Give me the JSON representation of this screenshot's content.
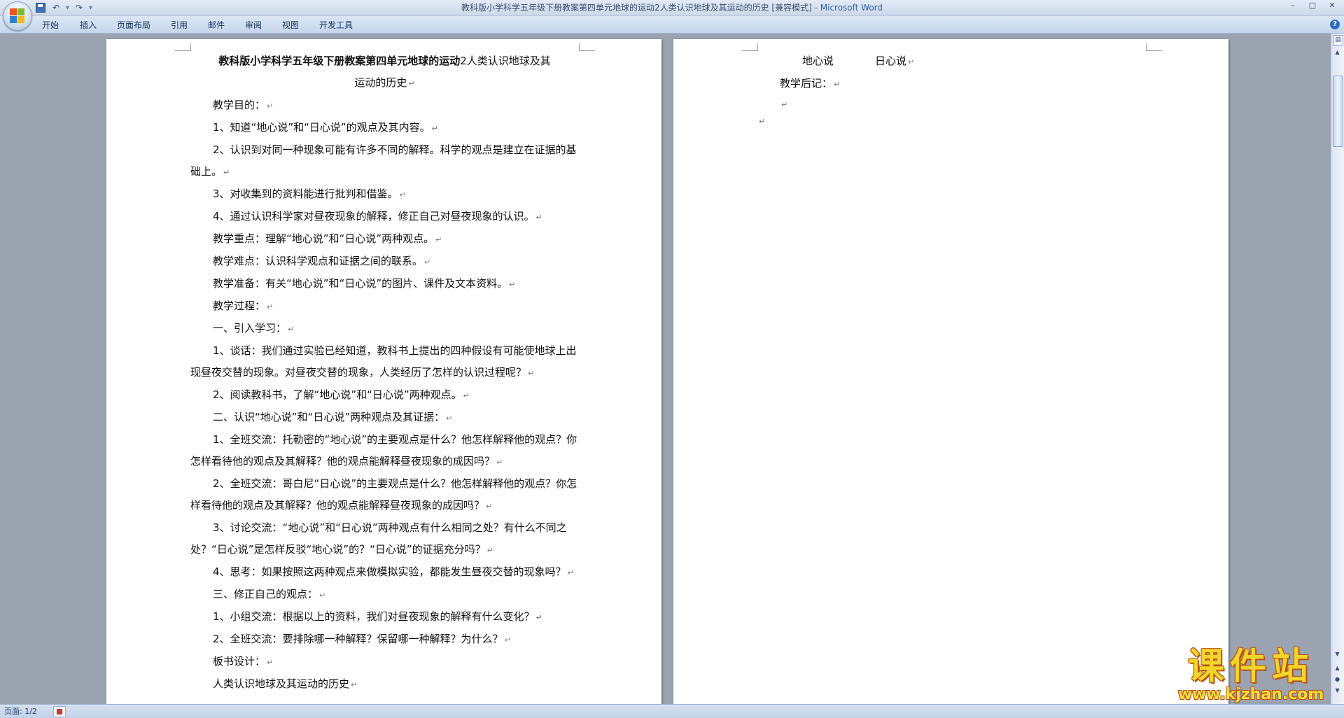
{
  "window": {
    "title_doc": "教科版小学科学五年级下册教案第四单元地球的运动2人类认识地球及其运动的历史 [兼容模式]",
    "title_sep": " - ",
    "title_app": "Microsoft Word",
    "minimize": "–",
    "maximize": "□",
    "close": "✕"
  },
  "qat": {
    "undo": "↶",
    "dropdown": "▾",
    "redo": "↷",
    "customize": "▾"
  },
  "ribbon": {
    "tabs": [
      "开始",
      "插入",
      "页面布局",
      "引用",
      "邮件",
      "审阅",
      "视图",
      "开发工具"
    ],
    "help": "?"
  },
  "document": {
    "paragraph_mark": "↵",
    "page1": {
      "title_bold": "教科版小学科学五年级下册教案第四单元地球的运动",
      "title_rest": "2人类认识地球及其",
      "title_line2": "运动的历史",
      "lines": [
        "教学目的：",
        "1、知道“地心说”和“日心说”的观点及其内容。",
        "2、认识到对同一种现象可能有许多不同的解释。科学的观点是建立在证据的基础上。",
        "3、对收集到的资料能进行批判和借鉴。",
        "4、通过认识科学家对昼夜现象的解释，修正自己对昼夜现象的认识。",
        "教学重点：理解“地心说”和“日心说”两种观点。",
        "教学难点：认识科学观点和证据之间的联系。",
        "教学准备：有关“地心说”和“日心说”的图片、课件及文本资料。",
        "教学过程：",
        "一、引入学习：",
        "1、谈话：我们通过实验已经知道，教科书上提出的四种假设有可能使地球上出现昼夜交替的现象。对昼夜交替的现象，人类经历了怎样的认识过程呢？",
        "2、阅读教科书，了解“地心说”和“日心说”两种观点。",
        "二、认识“地心说”和“日心说”两种观点及其证据：",
        "1、全班交流：托勒密的“地心说”的主要观点是什么？他怎样解释他的观点？你怎样看待他的观点及其解释？他的观点能解释昼夜现象的成因吗？",
        "2、全班交流：哥白尼“日心说”的主要观点是什么？他怎样解释他的观点？你怎样看待他的观点及其解释？他的观点能解释昼夜现象的成因吗？",
        "3、讨论交流：“地心说”和“日心说”两种观点有什么相同之处？有什么不同之处？“日心说”是怎样反驳“地心说”的？“日心说”的证据充分吗？",
        "4、思考：如果按照这两种观点来做模拟实验，都能发生昼夜交替的现象吗？",
        "三、修正自己的观点：",
        "1、小组交流：根据以上的资料，我们对昼夜现象的解释有什么变化？",
        "2、全班交流：要排除哪一种解释？保留哪一种解释？为什么？",
        "板书设计：",
        "人类认识地球及其运动的历史"
      ]
    },
    "page2": {
      "col1": "地心说",
      "col2": "日心说",
      "afterword": "教学后记："
    }
  },
  "statusbar": {
    "page_info": "页面: 1/2"
  },
  "watermark": {
    "cn": "课件站",
    "url": "www.kjzhan.com"
  },
  "colors": {
    "workspace": "#9ba3b1",
    "ribbon": "#c6d6ec",
    "title_app": "#2f5fa4"
  }
}
